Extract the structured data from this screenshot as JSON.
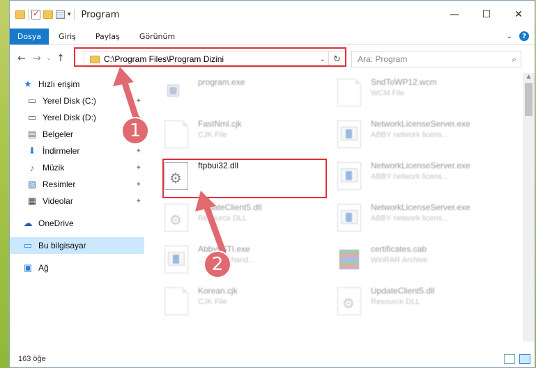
{
  "window": {
    "title": "Program",
    "controls": {
      "minimize": "—",
      "maximize": "☐",
      "close": "✕"
    }
  },
  "ribbon": {
    "file_tab": "Dosya",
    "tabs": [
      "Giriş",
      "Paylaş",
      "Görünüm"
    ],
    "expand": "⌄",
    "help": "?"
  },
  "nav": {
    "back": "←",
    "forward": "→",
    "up_chevron": "⌄",
    "up": "↑",
    "address": "C:\\Program Files\\Program Dizini",
    "dropdown": "⌄",
    "refresh": "↻",
    "search_placeholder": "Ara: Program",
    "search_icon": "⌕"
  },
  "sidebar": {
    "items": [
      {
        "label": "Hızlı erişim",
        "icon": "star-icon",
        "glyph": "★",
        "color": "#2a7fd4",
        "pinned": false
      },
      {
        "label": "Yerel Disk (C:)",
        "icon": "drive-icon",
        "glyph": "▭",
        "color": "#555",
        "pinned": true
      },
      {
        "label": "Yerel Disk (D:)",
        "icon": "drive-icon",
        "glyph": "▭",
        "color": "#555",
        "pinned": true
      },
      {
        "label": "Belgeler",
        "icon": "document-icon",
        "glyph": "▤",
        "color": "#666",
        "pinned": true
      },
      {
        "label": "İndirmeler",
        "icon": "download-icon",
        "glyph": "⬇",
        "color": "#2a7fd4",
        "pinned": true
      },
      {
        "label": "Müzik",
        "icon": "music-icon",
        "glyph": "♪",
        "color": "#2a7fd4",
        "pinned": true
      },
      {
        "label": "Resimler",
        "icon": "pictures-icon",
        "glyph": "▧",
        "color": "#4a7ab0",
        "pinned": true
      },
      {
        "label": "Videolar",
        "icon": "video-icon",
        "glyph": "▦",
        "color": "#444",
        "pinned": true
      },
      {
        "label": "OneDrive",
        "icon": "cloud-icon",
        "glyph": "☁",
        "color": "#1f5fb8",
        "pinned": false
      },
      {
        "label": "Bu bilgisayar",
        "icon": "computer-icon",
        "glyph": "▭",
        "color": "#2a7fd4",
        "pinned": false,
        "selected": true
      },
      {
        "label": "Ağ",
        "icon": "network-icon",
        "glyph": "▣",
        "color": "#2a7fd4",
        "pinned": false
      }
    ],
    "pin_glyph": "📌"
  },
  "files": [
    {
      "name": "program.exe",
      "type": "",
      "icon": "setup",
      "blur": true
    },
    {
      "name": "SndToWP12.wcm",
      "type": "WCM File",
      "icon": "doc",
      "blur": true
    },
    {
      "name": "FastNml.cjk",
      "type": "CJK File",
      "icon": "doc",
      "blur": true
    },
    {
      "name": "NetworkLicenseServer.exe",
      "type": "ABBY network licens...",
      "icon": "app",
      "blur": true
    },
    {
      "name": "ftpbui32.dll",
      "type": "",
      "icon": "gear",
      "blur": false
    },
    {
      "name": "NetworkLicenseServer.exe",
      "type": "ABBY network licens...",
      "icon": "app",
      "blur": true
    },
    {
      "name": "UpdateClient5.dll",
      "type": "Resource DLL",
      "icon": "gear",
      "blur": true
    },
    {
      "name": "NetworkLicenseServer.exe",
      "type": "ABBY network licens...",
      "icon": "app",
      "blur": true
    },
    {
      "name": "AbbyySTI.exe",
      "type": "...s event hand...",
      "icon": "app",
      "blur": true
    },
    {
      "name": "certificates.cab",
      "type": "WinRAR Archive",
      "icon": "archive",
      "blur": true
    },
    {
      "name": "Korean.cjk",
      "type": "CJK File",
      "icon": "doc",
      "blur": true
    },
    {
      "name": "UpdateClient5.dll",
      "type": "Resource DLL",
      "icon": "gear",
      "blur": true
    }
  ],
  "status": {
    "count": "163 öğe"
  },
  "annotations": {
    "step1": "1",
    "step2": "2",
    "color": "#e0303a"
  }
}
